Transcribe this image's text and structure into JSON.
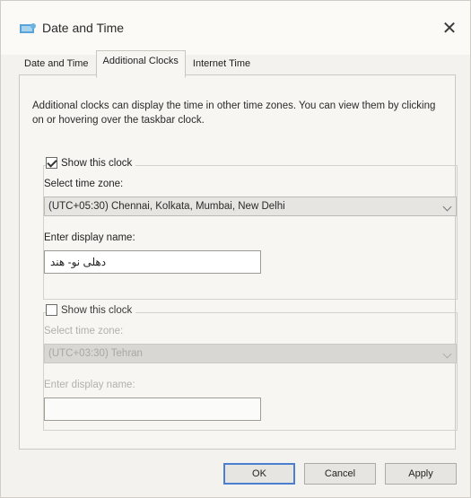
{
  "window": {
    "title": "Date and Time",
    "close_glyph": "✕"
  },
  "tabs": [
    {
      "label": "Date and Time",
      "active": false
    },
    {
      "label": "Additional Clocks",
      "active": true
    },
    {
      "label": "Internet Time",
      "active": false
    }
  ],
  "description": "Additional clocks can display the time in other time zones. You can view them by clicking on or hovering over the taskbar clock.",
  "clock1": {
    "show_label": "Show this clock",
    "checked": true,
    "timezone_label": "Select time zone:",
    "timezone_value": "(UTC+05:30) Chennai, Kolkata, Mumbai, New Delhi",
    "display_name_label": "Enter display name:",
    "display_name_value": "دهلی نو- هند"
  },
  "clock2": {
    "show_label": "Show this clock",
    "checked": false,
    "timezone_label": "Select time zone:",
    "timezone_value": "(UTC+03:30) Tehran",
    "display_name_label": "Enter display name:",
    "display_name_value": ""
  },
  "buttons": {
    "ok": "OK",
    "cancel": "Cancel",
    "apply": "Apply"
  },
  "colors": {
    "accent": "#4d7fd0",
    "icon": "#5aa3d8"
  }
}
